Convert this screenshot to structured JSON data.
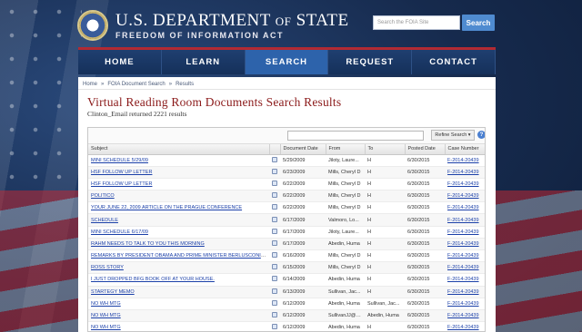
{
  "header": {
    "title_main": "U.S. DEPARTMENT",
    "title_of": "OF",
    "title_end": "STATE",
    "subtitle": "FREEDOM OF INFORMATION ACT",
    "search_placeholder": "Search the FOIA Site",
    "search_button": "Search"
  },
  "nav": {
    "tabs": [
      {
        "label": "HOME"
      },
      {
        "label": "LEARN"
      },
      {
        "label": "SEARCH",
        "active": true
      },
      {
        "label": "REQUEST"
      },
      {
        "label": "CONTACT"
      }
    ]
  },
  "breadcrumb": [
    "Home",
    "»",
    "FOIA Document Search",
    "»",
    "Results"
  ],
  "page": {
    "title": "Virtual Reading Room Documents Search Results",
    "returned": "Clinton_Email returned 2221 results"
  },
  "grid": {
    "refine_label": "Refine Search",
    "columns": [
      "Subject",
      "",
      "Document Date",
      "From",
      "To",
      "Posted Date",
      "Case Number"
    ],
    "rows": [
      {
        "subject": "MINI SCHEDULE 5/29/09",
        "date": "5/29/2009",
        "from": "Jiloty, Laure...",
        "to": "H",
        "posted": "6/30/2015",
        "case": "F-2014-20439"
      },
      {
        "subject": "HSF FOLLOW UP LETTER",
        "date": "6/23/2009",
        "from": "Mills, Cheryl D",
        "to": "H",
        "posted": "6/30/2015",
        "case": "F-2014-20439"
      },
      {
        "subject": "HSF FOLLOW UP LETTER",
        "date": "6/22/2009",
        "from": "Mills, Cheryl D",
        "to": "H",
        "posted": "6/30/2015",
        "case": "F-2014-20439"
      },
      {
        "subject": "POLITICO",
        "date": "6/22/2009",
        "from": "Mills, Cheryl D",
        "to": "H",
        "posted": "6/30/2015",
        "case": "F-2014-20439"
      },
      {
        "subject": "YOUR JUNE 22, 2009 ARTICLE ON THE PRAGUE CONFERENCE",
        "date": "6/22/2009",
        "from": "Mills, Cheryl D",
        "to": "H",
        "posted": "6/30/2015",
        "case": "F-2014-20439"
      },
      {
        "subject": "SCHEDULE",
        "date": "6/17/2009",
        "from": "Valmoro, Lo...",
        "to": "H",
        "posted": "6/30/2015",
        "case": "F-2014-20439"
      },
      {
        "subject": "MINI SCHEDULE 6/17/09",
        "date": "6/17/2009",
        "from": "Jiloty, Laure...",
        "to": "H",
        "posted": "6/30/2015",
        "case": "F-2014-20439"
      },
      {
        "subject": "RAHM NEEDS TO TALK TO YOU THIS MORNING",
        "date": "6/17/2009",
        "from": "Abedin, Huma",
        "to": "H",
        "posted": "6/30/2015",
        "case": "F-2014-20439"
      },
      {
        "subject": "REMARKS BY PRESIDENT OBAMA AND PRIME MINISTER BERLUSCONI IN P...",
        "date": "6/16/2009",
        "from": "Mills, Cheryl D",
        "to": "H",
        "posted": "6/30/2015",
        "case": "F-2014-20439"
      },
      {
        "subject": "ROSS STORY",
        "date": "6/15/2009",
        "from": "Mills, Cheryl D",
        "to": "H",
        "posted": "6/30/2015",
        "case": "F-2014-20439"
      },
      {
        "subject": "I JUST DROPPED BFG BOOK OFF AT YOUR HOUSE.",
        "date": "6/14/2009",
        "from": "Abedin, Huma",
        "to": "H",
        "posted": "6/30/2015",
        "case": "F-2014-20439"
      },
      {
        "subject": "STARTEGY MEMO",
        "date": "6/13/2009",
        "from": "Sullivan, Jac...",
        "to": "H",
        "posted": "6/30/2015",
        "case": "F-2014-20439"
      },
      {
        "subject": "NO WH MTG",
        "date": "6/12/2009",
        "from": "Abedin, Huma",
        "to": "Sullivan, Jac...",
        "posted": "6/30/2015",
        "case": "F-2014-20439"
      },
      {
        "subject": "NO WH MTG",
        "date": "6/12/2009",
        "from": "SullivanJJ@s...",
        "to": "Abedin, Huma",
        "posted": "6/30/2015",
        "case": "F-2014-20439"
      },
      {
        "subject": "NO WH MTG",
        "date": "6/12/2009",
        "from": "Abedin, Huma",
        "to": "H",
        "posted": "6/30/2015",
        "case": "F-2014-20439"
      }
    ]
  }
}
